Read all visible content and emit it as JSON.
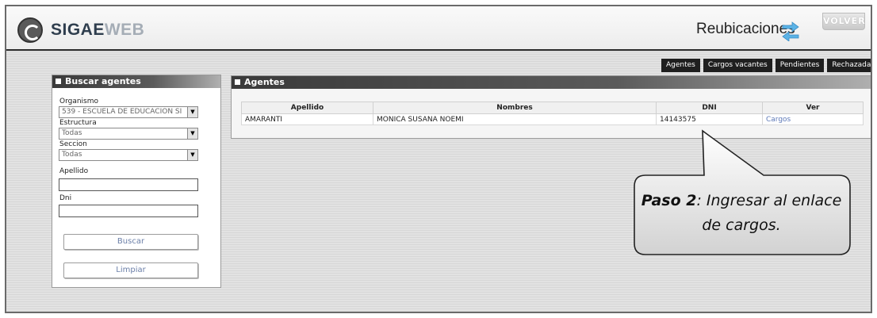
{
  "app": {
    "name_part1": "SIGAE",
    "name_part2": "WEB"
  },
  "header": {
    "title": "Reubicaciones",
    "back_label": "VOLVER"
  },
  "tabs": [
    {
      "label": "Agentes"
    },
    {
      "label": "Cargos vacantes"
    },
    {
      "label": "Pendientes"
    },
    {
      "label": "Rechazadas"
    }
  ],
  "search": {
    "title": "Buscar agentes",
    "organismo_label": "Organismo",
    "organismo_value": "539 - ESCUELA DE EDUCACION SI",
    "estructura_label": "Estructura",
    "estructura_value": "Todas",
    "seccion_label": "Seccion",
    "seccion_value": "Todas",
    "apellido_label": "Apellido",
    "apellido_value": "",
    "dni_label": "Dni",
    "dni_value": "",
    "buscar_label": "Buscar",
    "limpiar_label": "Limpiar"
  },
  "agents": {
    "title": "Agentes",
    "columns": [
      "Apellido",
      "Nombres",
      "DNI",
      "Ver"
    ],
    "rows": [
      {
        "apellido": "AMARANTI",
        "nombres": "MONICA SUSANA NOEMI",
        "dni": "14143575",
        "ver": "Cargos"
      }
    ]
  },
  "callout": {
    "step": "Paso 2",
    "text": ": Ingresar al enlace de cargos."
  },
  "colors": {
    "accent": "#1f1f1f",
    "link": "#5d79b8",
    "arrows": "#5bb3e6"
  }
}
